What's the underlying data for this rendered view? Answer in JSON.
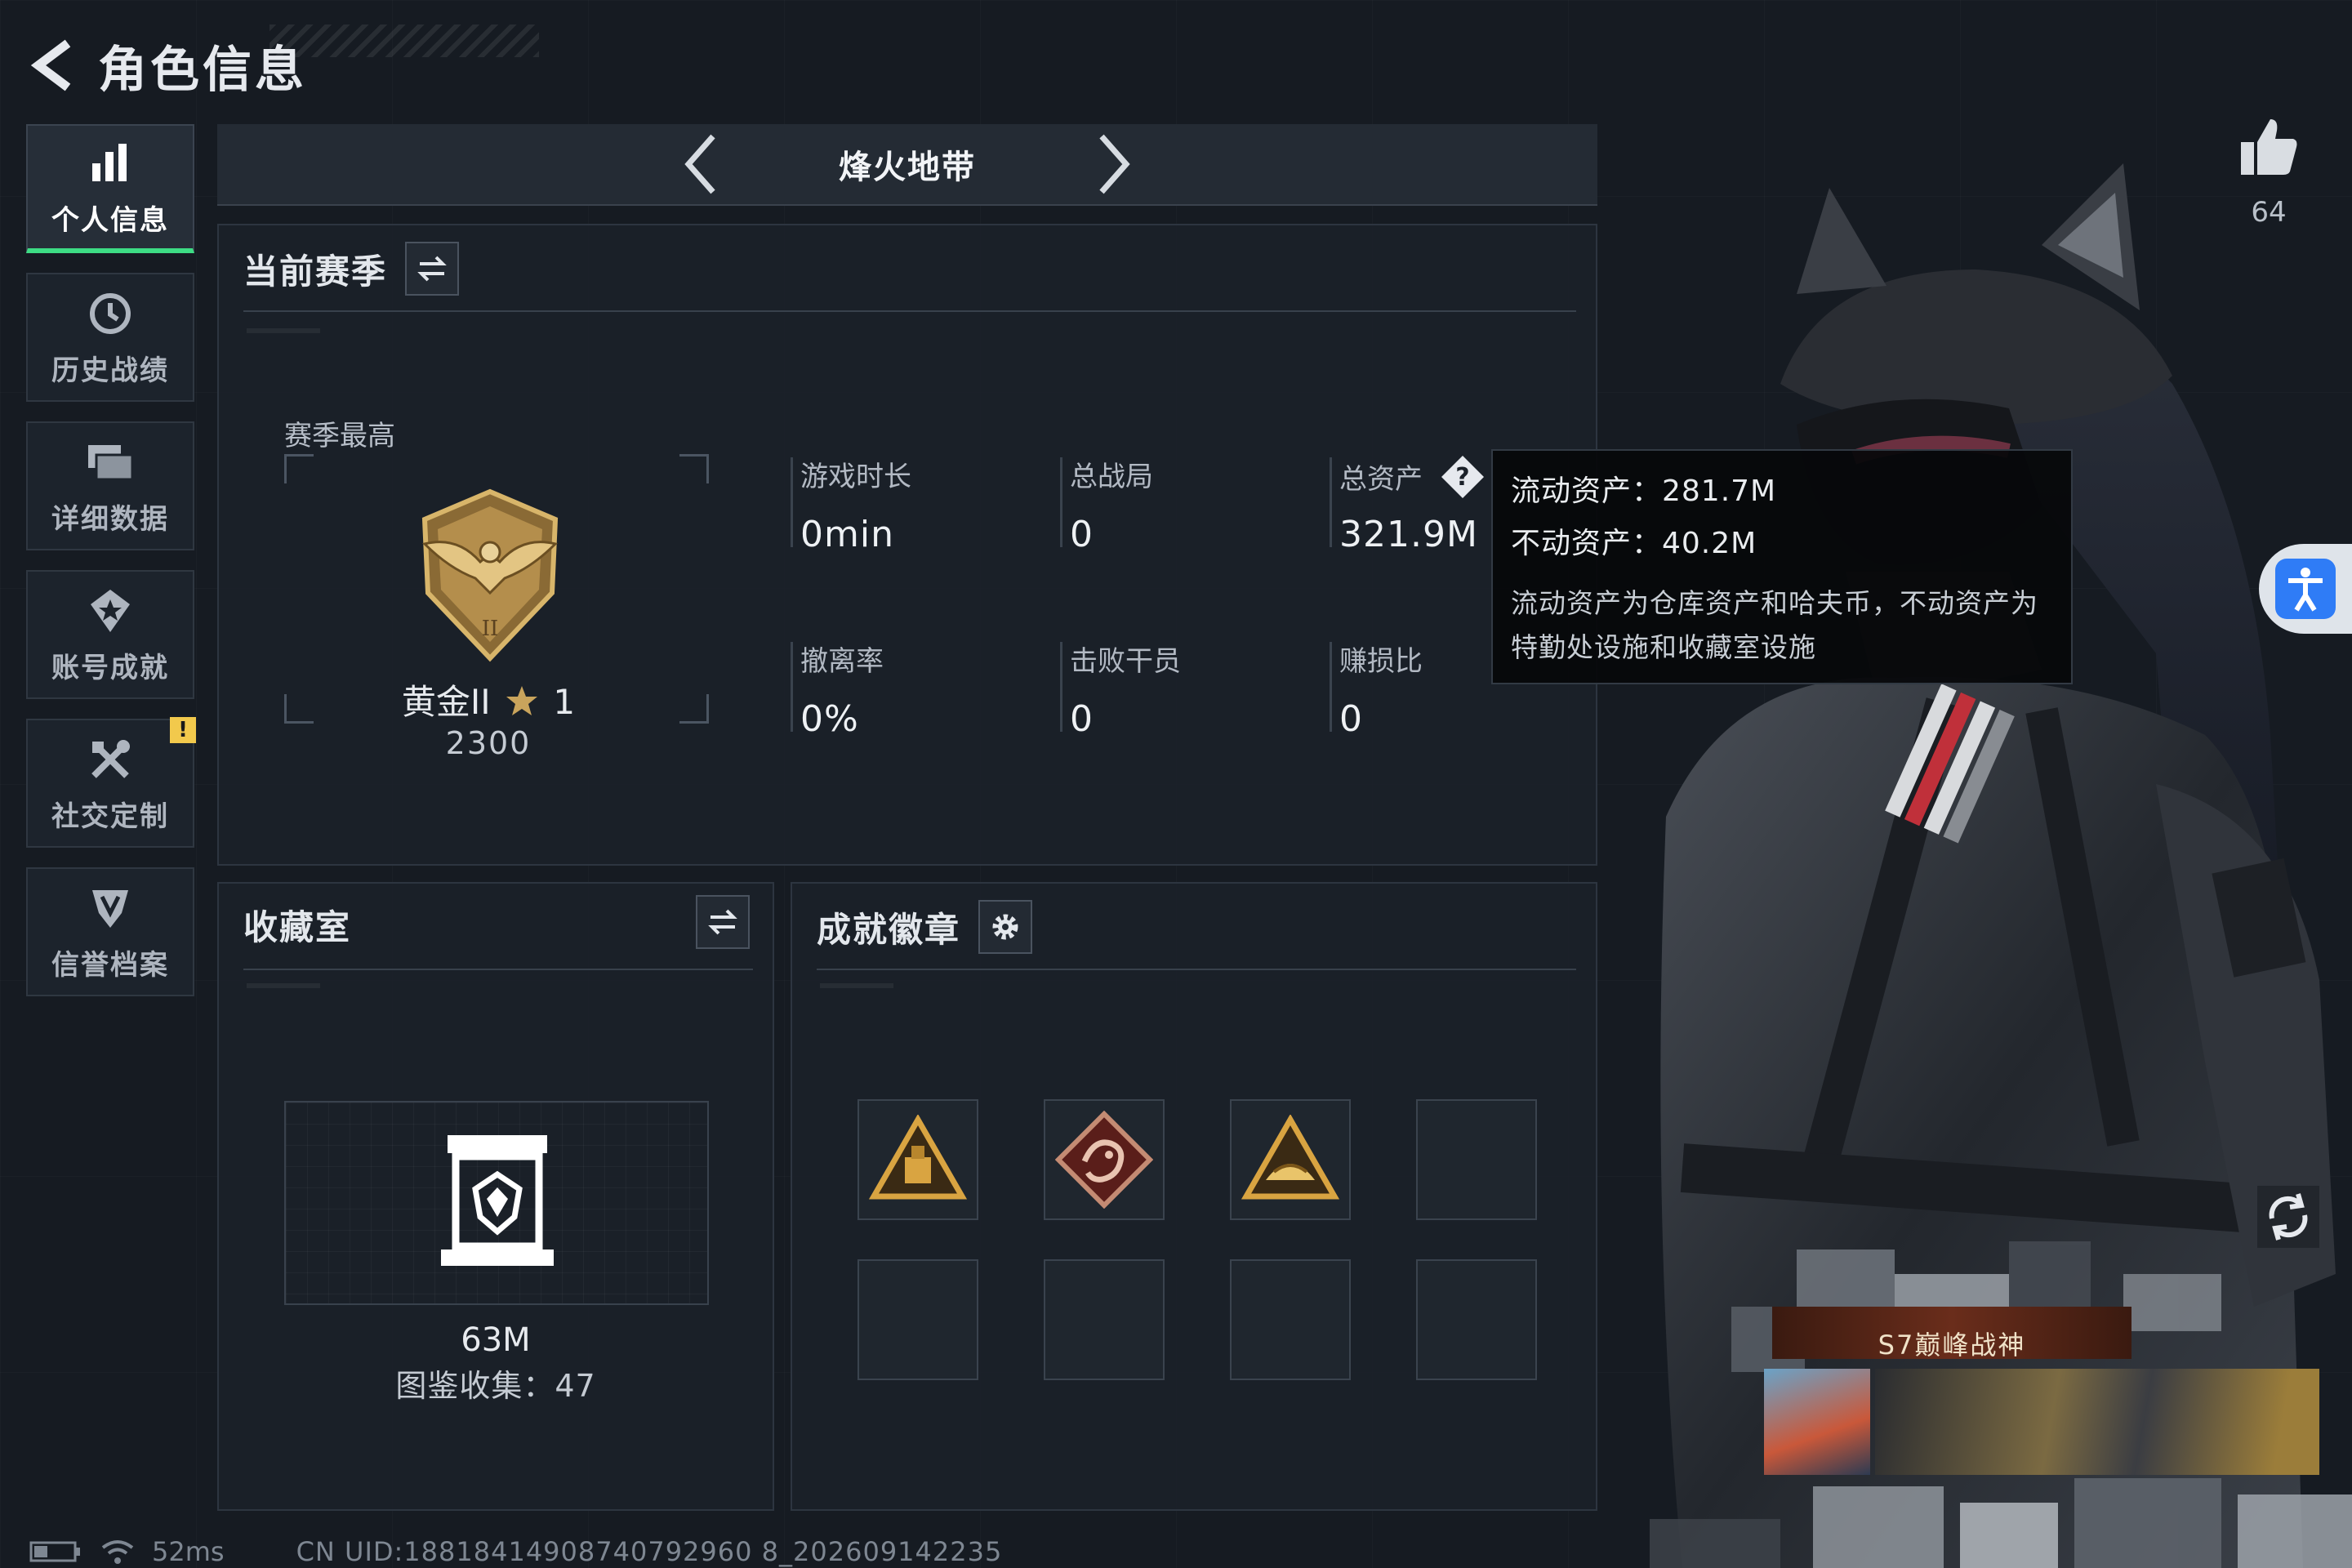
{
  "header": {
    "title": "角色信息"
  },
  "sidebar": {
    "items": [
      {
        "label": "个人信息",
        "icon": "bar-chart-icon",
        "active": true
      },
      {
        "label": "历史战绩",
        "icon": "history-clock-icon"
      },
      {
        "label": "详细数据",
        "icon": "data-folder-icon"
      },
      {
        "label": "账号成就",
        "icon": "achievement-star-icon"
      },
      {
        "label": "社交定制",
        "icon": "tools-icon",
        "badge": "!"
      },
      {
        "label": "信誉档案",
        "icon": "credit-shield-icon"
      }
    ]
  },
  "mode_bar": {
    "name": "烽火地带"
  },
  "season": {
    "title": "当前赛季",
    "best_label": "赛季最高",
    "rank_name": "黄金II",
    "rank_stars": "1",
    "rank_score": "2300",
    "stats": [
      {
        "label": "游戏时长",
        "value": "0min"
      },
      {
        "label": "总战局",
        "value": "0"
      },
      {
        "label": "总资产",
        "value": "321.9M"
      },
      {
        "label": "撤离率",
        "value": "0%"
      },
      {
        "label": "击败干员",
        "value": "0"
      },
      {
        "label": "赚损比",
        "value": "0"
      }
    ]
  },
  "tooltip": {
    "liquid": "流动资产：281.7M",
    "fixed": "不动资产：40.2M",
    "description": "流动资产为仓库资产和哈夫币，不动资产为特勤处设施和收藏室设施"
  },
  "collection": {
    "title": "收藏室",
    "value": "63M",
    "count": "图鉴收集：47"
  },
  "achievements": {
    "title": "成就徽章",
    "badges": [
      "gold-triangle-badge",
      "dragon-diamond-badge",
      "gold-triangle-badge-2",
      "",
      "",
      "",
      "",
      ""
    ]
  },
  "profile": {
    "likes": "64",
    "banner_title": "S7巅峰战神"
  },
  "status_bar": {
    "ping": "52ms",
    "uid": "CN UID:18818414908740792960 8_202609142235"
  },
  "colors": {
    "accent": "#3ddc84",
    "warning": "#f2c94c",
    "access_blue": "#2f7cf6",
    "rank_gold": "#c9a45c"
  }
}
